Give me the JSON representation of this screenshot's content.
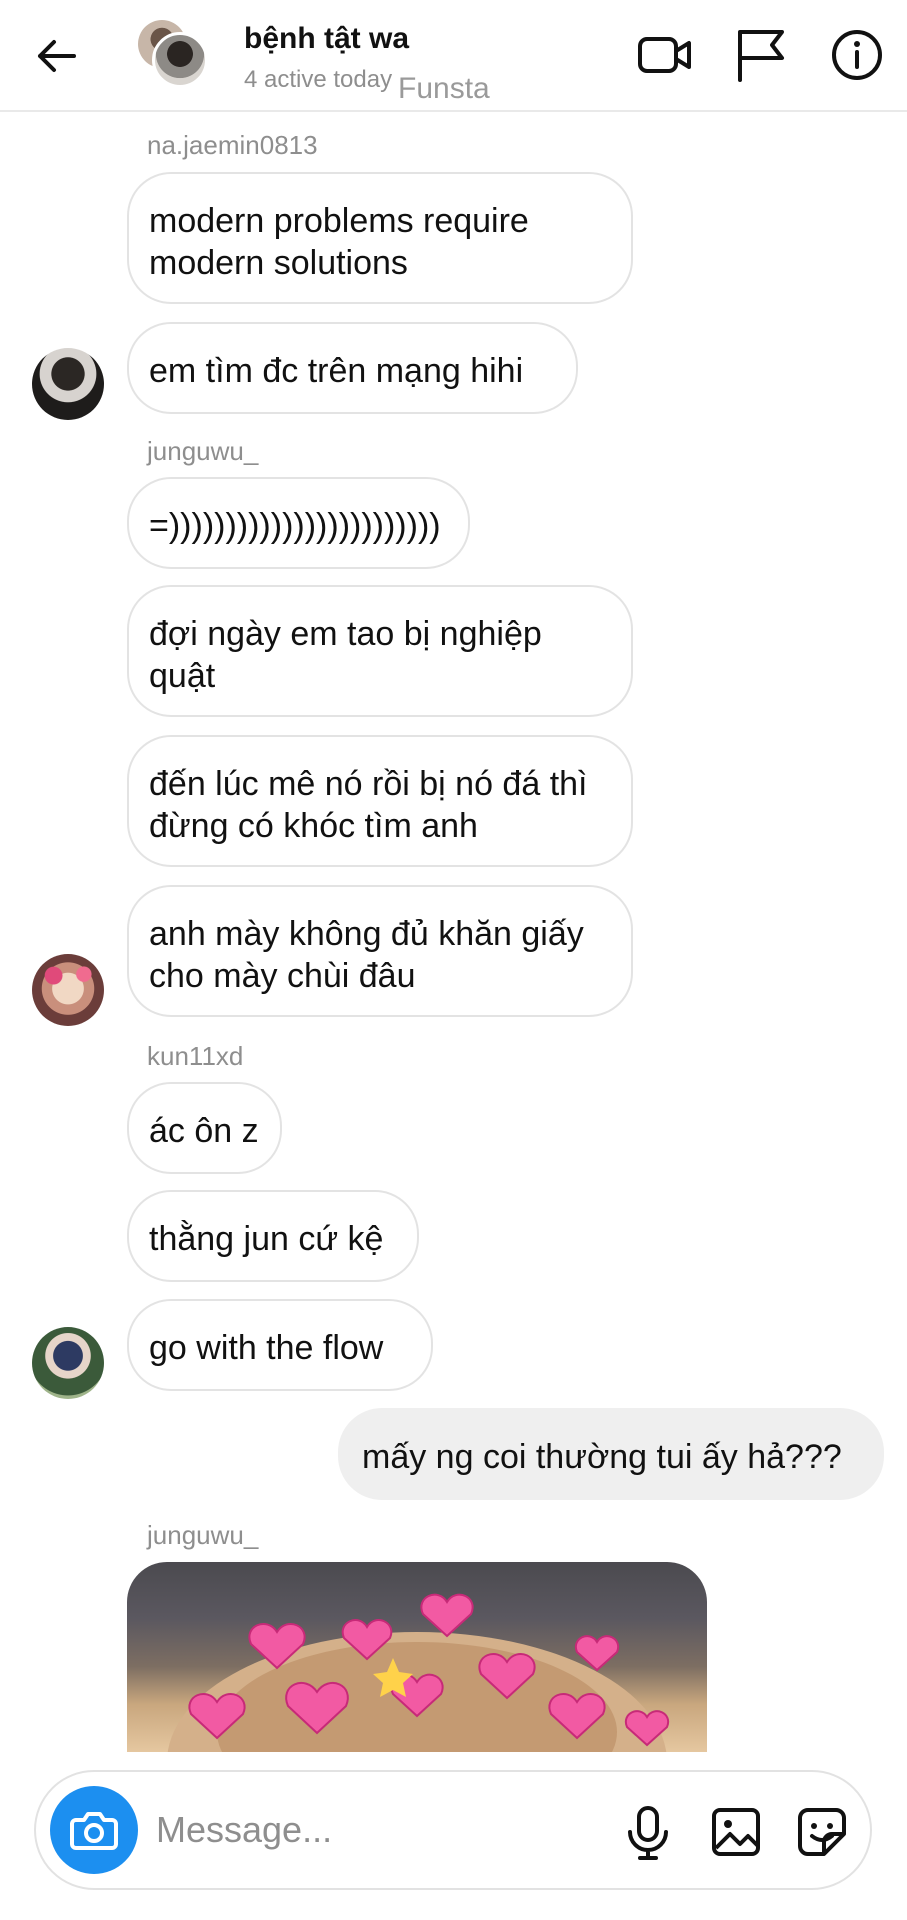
{
  "header": {
    "title": "bệnh tật wa",
    "subtitle": "4 active today",
    "watermark": "Funsta"
  },
  "messages": [
    {
      "sender": "na.jaemin0813",
      "texts": [
        "modern problems require modern solutions",
        "em tìm đc trên mạng hihi"
      ]
    },
    {
      "sender": "junguwu_",
      "texts": [
        "=))))))))))))))))))))))))",
        "đợi ngày em tao bị nghiệp quật",
        "đến lúc mê nó rồi bị nó đá thì đừng có khóc tìm anh",
        "anh mày không đủ khăn giấy cho mày chùi đâu"
      ]
    },
    {
      "sender": "kun11xd",
      "texts": [
        "ác ôn z",
        "thằng jun cứ kệ",
        "go with the flow"
      ]
    },
    {
      "sender": "",
      "texts": [
        "mấy ng coi thường tui ấy hả???"
      ]
    },
    {
      "sender": "junguwu_",
      "texts": []
    }
  ],
  "composer": {
    "placeholder": "Message..."
  },
  "icons": {
    "back": "arrow-left-icon",
    "video": "video-call-icon",
    "flag": "flag-icon",
    "info": "info-icon",
    "camera": "camera-icon",
    "mic": "microphone-icon",
    "gallery": "image-icon",
    "sticker": "sticker-icon"
  },
  "colors": {
    "accent": "#1c8ff0",
    "sent_bubble": "#efefef",
    "muted_text": "#8e8e8e"
  }
}
